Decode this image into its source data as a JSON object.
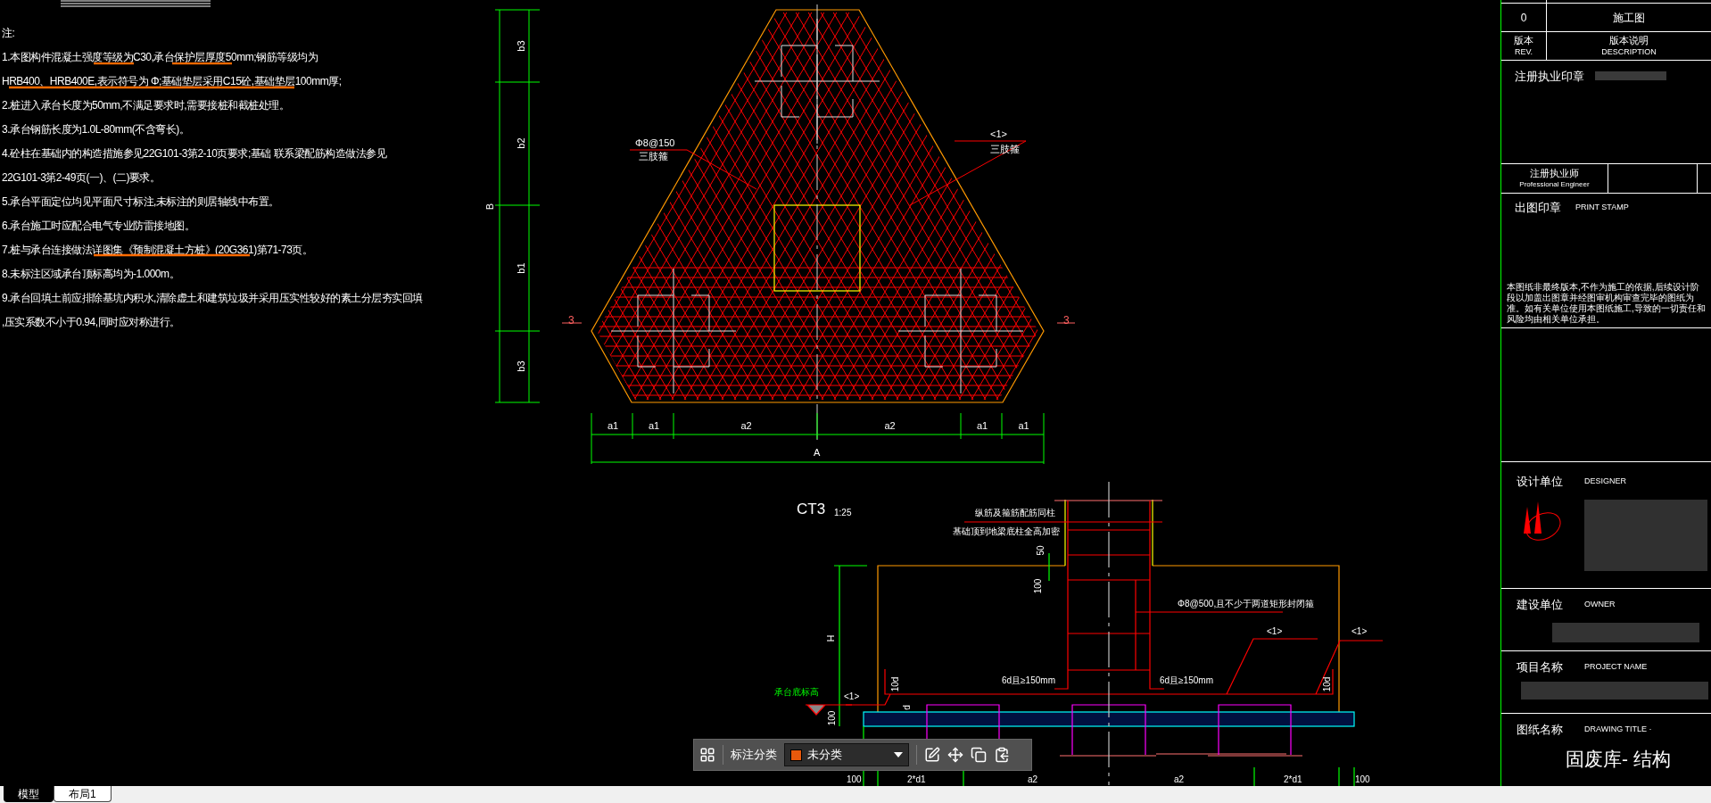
{
  "notes": {
    "title": "注:",
    "lines": [
      "1.本图构件混凝土强度等级为C30,承台保护层厚度50mm;钢筋等级均为",
      "HRB400、HRB400E,表示符号为 Φ;基础垫层采用C15砼,基础垫层100mm厚;",
      "2.桩进入承台长度为50mm,不满足要求时,需要接桩和截桩处理。",
      "3.承台钢筋长度为1.0L-80mm(不含弯长)。",
      "4.砼柱在基础内的构造措施参见22G101-3第2-10页要求;基础 联系梁配筋构造做法参见",
      "22G101-3第2-49页(一)、(二)要求。",
      "5.承台平面定位均见平面尺寸标注,未标注的则居轴线中布置。",
      "6.承台施工时应配合电气专业防雷接地图。",
      "7.桩与承台连接做法详图集《预制混凝土方桩》(20G361)第71-73页。",
      "8.未标注区域承台顶标高均为-1.000m。",
      "9.承台回填土前应排除基坑内积水,清除虚土和建筑垃圾并采用压实性较好的素土分层夯实回填",
      ",压实系数不小于0.94,同时应对称进行。"
    ]
  },
  "plan_view": {
    "left_leader": [
      "Φ8@150",
      "三肢箍"
    ],
    "right_leader": [
      "<1>",
      "三肢箍"
    ],
    "section_marks": [
      "3",
      "3"
    ],
    "bottom_dims": [
      "a1",
      "a1",
      "a2",
      "a2",
      "a1",
      "a1"
    ],
    "bottom_total": "A",
    "left_dims": [
      "b3",
      "b2",
      "b1",
      "b3"
    ],
    "left_total": "B"
  },
  "section_view": {
    "title": "CT3",
    "scale": "1:25",
    "column_notes": [
      "纵筋及箍筋配筋同柱",
      "基础顶到地梁底柱全高加密"
    ],
    "stirrup_note": "Φ8@500,且不少于两道矩形封闭箍",
    "rebar_marks": [
      "<1>",
      "<1>",
      "<1>"
    ],
    "anchor_notes": [
      "6d且≥150mm",
      "6d且≥150mm"
    ],
    "height_label": "H",
    "column_dims": [
      "50",
      "100"
    ],
    "hook_labels": [
      "10d",
      "10d"
    ],
    "level_label": "承台底标高",
    "cushion_dim": "100",
    "cover_dim": "d",
    "bottom_dims": [
      "100",
      "2*d1",
      "a2",
      "a2",
      "2*d1",
      "100"
    ]
  },
  "title_block": {
    "rev_value": "0",
    "rev_desc_value": "施工图",
    "rev_label": [
      "版本",
      "REV."
    ],
    "rev_desc_label": [
      "版本说明",
      "DESCRIPTION"
    ],
    "seal_label": "注册执业印章",
    "engineer_label": [
      "注册执业师",
      "Professional Engineer"
    ],
    "stamp_label": [
      "出图印章",
      "PRINT STAMP"
    ],
    "disclaimer": "本图纸非最终版本,不作为施工的依据,后续设计阶段以加盖出图章并经图审机构审查完毕的图纸为准。如有关单位使用本图纸施工,导致的一切责任和风险均由相关单位承担。",
    "designer_label": [
      "设计单位",
      "DESIGNER"
    ],
    "owner_label": [
      "建设单位",
      "OWNER"
    ],
    "project_label": [
      "项目名称",
      "PROJECT NAME"
    ],
    "drawing_label": [
      "图纸名称",
      "DRAWING TITLE ·"
    ],
    "drawing_title": "固废库- 结构"
  },
  "toolbar": {
    "label": "标注分类",
    "category": "未分类"
  },
  "tabs": [
    {
      "label": "模型",
      "selected": true
    },
    {
      "label": "布局1",
      "selected": false
    }
  ]
}
